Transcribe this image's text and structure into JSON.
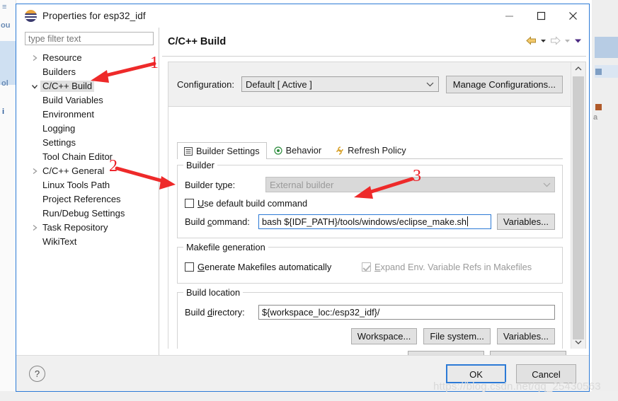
{
  "window": {
    "title": "Properties for esp32_idf",
    "icon": "eclipse-logo-icon",
    "minimize_label": "—",
    "maximize_label": "□",
    "close_label": "✕"
  },
  "filter": {
    "placeholder": "type filter text",
    "value": ""
  },
  "tree": {
    "items": [
      {
        "label": "Resource",
        "indent": 0,
        "twisty": "collapsed",
        "selected": false
      },
      {
        "label": "Builders",
        "indent": 0,
        "twisty": "none",
        "selected": false
      },
      {
        "label": "C/C++ Build",
        "indent": 0,
        "twisty": "expanded",
        "selected": true
      },
      {
        "label": "Build Variables",
        "indent": 1,
        "twisty": "none",
        "selected": false
      },
      {
        "label": "Environment",
        "indent": 1,
        "twisty": "none",
        "selected": false
      },
      {
        "label": "Logging",
        "indent": 1,
        "twisty": "none",
        "selected": false
      },
      {
        "label": "Settings",
        "indent": 1,
        "twisty": "none",
        "selected": false
      },
      {
        "label": "Tool Chain Editor",
        "indent": 1,
        "twisty": "none",
        "selected": false
      },
      {
        "label": "C/C++ General",
        "indent": 0,
        "twisty": "collapsed",
        "selected": false
      },
      {
        "label": "Linux Tools Path",
        "indent": 0,
        "twisty": "none",
        "selected": false
      },
      {
        "label": "Project References",
        "indent": 0,
        "twisty": "none",
        "selected": false
      },
      {
        "label": "Run/Debug Settings",
        "indent": 0,
        "twisty": "none",
        "selected": false
      },
      {
        "label": "Task Repository",
        "indent": 0,
        "twisty": "collapsed",
        "selected": false
      },
      {
        "label": "WikiText",
        "indent": 0,
        "twisty": "none",
        "selected": false
      }
    ]
  },
  "page": {
    "title": "C/C++ Build",
    "nav": {
      "back_icon": "back-arrow-icon",
      "back_menu_icon": "chevron-down-icon",
      "forward_icon": "forward-arrow-icon",
      "forward_menu_icon": "chevron-down-icon",
      "overflow_icon": "chevron-down-icon"
    }
  },
  "configuration": {
    "label": "Configuration:",
    "value": "Default  [ Active ]",
    "dropdown_icon": "chevron-down-icon",
    "manage_button": "Manage Configurations..."
  },
  "tabs": [
    {
      "label": "Builder Settings",
      "icon": "list-icon",
      "active": true
    },
    {
      "label": "Behavior",
      "icon": "radio-target-icon",
      "active": false
    },
    {
      "label": "Refresh Policy",
      "icon": "refresh-link-icon",
      "active": false
    }
  ],
  "builder_group": {
    "title": "Builder",
    "builder_type_label": "Builder type:",
    "builder_type_value": "External builder",
    "builder_type_disabled": true,
    "use_default_label": "Use default build command",
    "use_default_checked": false,
    "build_command_label": "Build command:",
    "build_command_value": "bash ${IDF_PATH}/tools/windows/eclipse_make.sh",
    "variables_button": "Variables..."
  },
  "makefile_group": {
    "title": "Makefile generation",
    "generate_label": "Generate Makefiles automatically",
    "generate_checked": false,
    "expand_label": "Expand Env. Variable Refs in Makefiles",
    "expand_checked": true,
    "expand_disabled": true
  },
  "build_location_group": {
    "title": "Build location",
    "build_directory_label": "Build directory:",
    "build_directory_value": "${workspace_loc:/esp32_idf}/",
    "workspace_button": "Workspace...",
    "filesystem_button": "File system...",
    "variables_button": "Variables..."
  },
  "scrollbar": {
    "up_icon": "chevron-up-icon",
    "down_icon": "chevron-down-icon"
  },
  "footer": {
    "help_icon": "question-mark-icon",
    "ok_button": "OK",
    "cancel_button": "Cancel"
  },
  "annotations": [
    {
      "number": "1",
      "target": "c-cpp-build-tree-item"
    },
    {
      "number": "2",
      "target": "use-default-build-command-checkbox"
    },
    {
      "number": "3",
      "target": "build-command-field"
    }
  ],
  "watermark": "https://blog.csdn.net/qq_25430563",
  "colors": {
    "accent": "#2c7ad6",
    "annotation": "#ec1c24",
    "selection": "#e0e0e0",
    "panel": "#f0f0f0"
  }
}
